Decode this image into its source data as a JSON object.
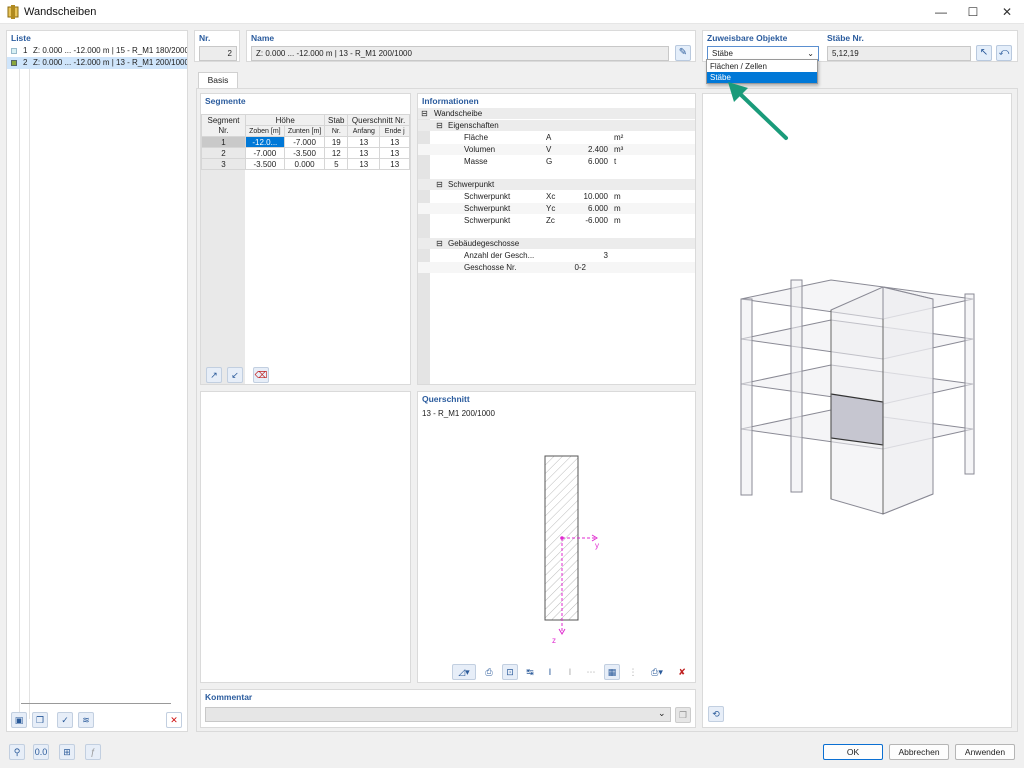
{
  "window": {
    "title": "Wandscheiben",
    "icon": "wall-icon",
    "controls": [
      "—",
      "☐",
      "✕"
    ]
  },
  "list": {
    "header": "Liste",
    "items": [
      {
        "num": "1",
        "text": "Z: 0.000 ... -12.000 m | 15 - R_M1 180/2000",
        "swatch": "#d8f0f4"
      },
      {
        "num": "2",
        "text": "Z: 0.000 ... -12.000 m | 13 - R_M1 200/1000",
        "swatch": "#8aa63a"
      }
    ]
  },
  "nr": {
    "label": "Nr.",
    "value": "2"
  },
  "name": {
    "label": "Name",
    "value": "Z: 0.000 ... -12.000  m | 13 - R_M1 200/1000"
  },
  "assign": {
    "label": "Zuweisbare Objekte",
    "selected": "Stäbe",
    "options": [
      "Flächen / Zellen",
      "Stäbe"
    ],
    "bars_label": "Stäbe Nr.",
    "bars_value": "5,12,19"
  },
  "tabs": [
    "Basis"
  ],
  "segments": {
    "header": "Segmente",
    "col_segment": "Segment",
    "col_nr": "Nr.",
    "col_hoehe": "Höhe",
    "col_zoben": "Zoben [m]",
    "col_zunten": "Zunten [m]",
    "col_stab": "Stab",
    "col_stab_nr": "Nr.",
    "col_qs": "Querschnitt Nr.",
    "col_anfang": "Anfang",
    "col_ende": "Ende j",
    "rows": [
      [
        "1",
        "-12.0...",
        "-7.000",
        "19",
        "13",
        "13"
      ],
      [
        "2",
        "-7.000",
        "-3.500",
        "12",
        "13",
        "13"
      ],
      [
        "3",
        "-3.500",
        "0.000",
        "5",
        "13",
        "13"
      ]
    ]
  },
  "info": {
    "header": "Informationen",
    "root": "Wandscheibe",
    "groups": [
      {
        "name": "Eigenschaften",
        "rows": [
          [
            "Fläche",
            "A",
            "",
            "m²"
          ],
          [
            "Volumen",
            "V",
            "2.400",
            "m³"
          ],
          [
            "Masse",
            "G",
            "6.000",
            "t"
          ]
        ]
      },
      {
        "name": "Schwerpunkt",
        "rows": [
          [
            "Schwerpunkt",
            "Xc",
            "10.000",
            "m"
          ],
          [
            "Schwerpunkt",
            "Yc",
            "6.000",
            "m"
          ],
          [
            "Schwerpunkt",
            "Zc",
            "-6.000",
            "m"
          ]
        ]
      },
      {
        "name": "Gebäudegeschosse",
        "rows": [
          [
            "Anzahl der Gesch...",
            "",
            "3",
            ""
          ],
          [
            "Geschosse Nr.",
            "",
            "0-2",
            ""
          ]
        ]
      }
    ]
  },
  "qs": {
    "header": "Querschnitt",
    "name": "13 - R_M1 200/1000",
    "axis_y": "y",
    "axis_z": "z"
  },
  "comment": {
    "label": "Kommentar",
    "value": ""
  },
  "footer": {
    "ok": "OK",
    "cancel": "Abbrechen",
    "apply": "Anwenden"
  },
  "colors": {
    "accent": "#2b5c9e",
    "selection": "#0078d7",
    "arrow": "#1a9b7a",
    "axis": "#e02bd0"
  }
}
